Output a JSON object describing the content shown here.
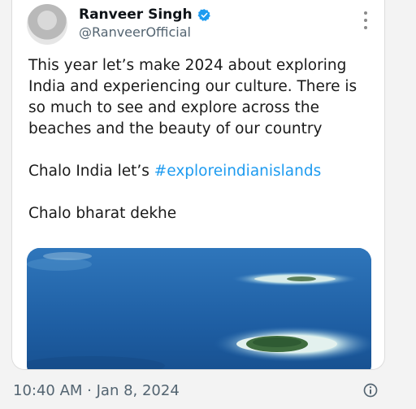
{
  "tweet": {
    "author_name": "Ranveer Singh",
    "author_handle": "@RanveerOfficial",
    "verified": true,
    "lines": [
      "This year let’s make 2024 about exploring India and experiencing our culture. There is so much to see and explore across the beaches and the beauty of our country"
    ],
    "line2_prefix": "Chalo India let’s ",
    "hashtag": "#exploreindianislands",
    "line3": "Chalo bharat dekhe",
    "timestamp": "10:40 AM · Jan 8, 2024"
  },
  "icons": {
    "verified": "verified-badge-icon",
    "more": "more-vertical-icon",
    "info": "info-icon"
  },
  "colors": {
    "accent": "#1d9bf0",
    "text": "#0f1419",
    "secondary": "#536471"
  }
}
